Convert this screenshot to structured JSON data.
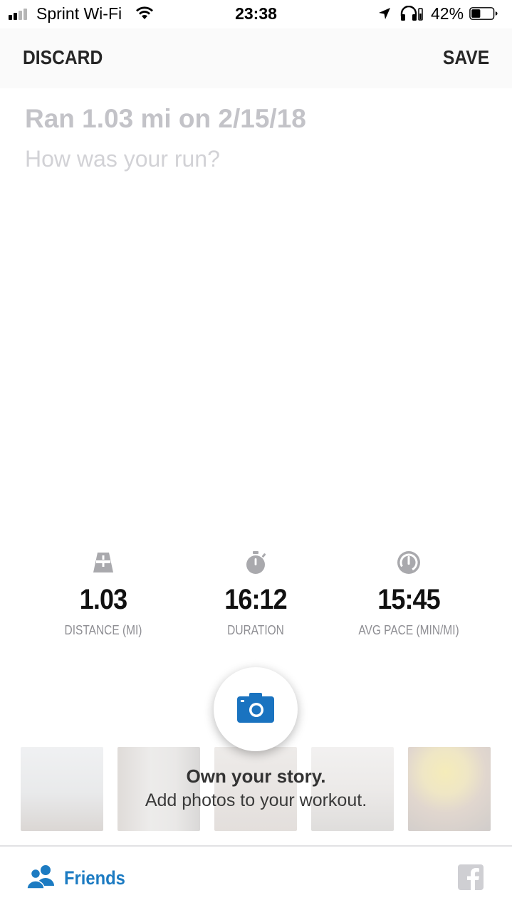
{
  "status_bar": {
    "carrier": "Sprint Wi-Fi",
    "time": "23:38",
    "battery_percent": "42%",
    "battery_level": 0.42,
    "signal_bars_filled": 2,
    "signal_bars_total": 4,
    "icons": [
      "signal-icon",
      "wifi-icon",
      "location-arrow-icon",
      "headphones-icon",
      "battery-icon"
    ]
  },
  "nav": {
    "discard_label": "DISCARD",
    "save_label": "SAVE"
  },
  "workout": {
    "title": "Ran 1.03 mi on 2/15/18",
    "note_value": "",
    "note_placeholder": "How was your run?"
  },
  "stats": [
    {
      "icon": "road-icon",
      "value": "1.03",
      "label": "DISTANCE (MI)"
    },
    {
      "icon": "stopwatch-icon",
      "value": "16:12",
      "label": "DURATION"
    },
    {
      "icon": "speedometer-icon",
      "value": "15:45",
      "label": "AVG PACE (MIN/MI)"
    }
  ],
  "photos": {
    "camera_icon": "camera-icon",
    "promo_title": "Own your story.",
    "promo_subtitle": "Add photos to your workout."
  },
  "bottom": {
    "friends_label": "Friends",
    "friends_icon": "friends-icon",
    "share_icon": "facebook-icon"
  },
  "colors": {
    "accent": "#1c7bc2",
    "camera_blue": "#1a73c0",
    "title_gray": "#c3c3c8",
    "label_gray": "#8e8e93",
    "nav_background": "#fafafa"
  }
}
